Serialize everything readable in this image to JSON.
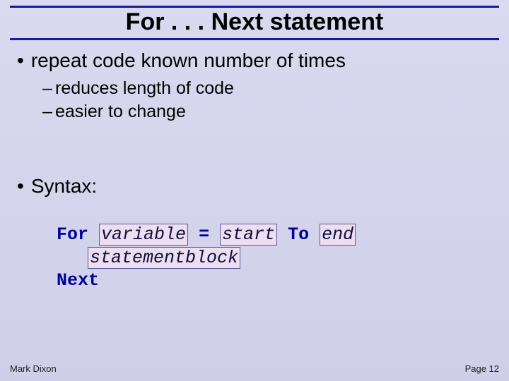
{
  "title": "For . . . Next statement",
  "bullets": {
    "main1": "repeat code known number of times",
    "sub1": "reduces length of code",
    "sub2": "easier to change",
    "main2": "Syntax:"
  },
  "code": {
    "kw_for": "For",
    "ph_variable": "variable",
    "eq": " = ",
    "ph_start": "start",
    "kw_to": " To ",
    "ph_end": "end",
    "ph_block": "statementblock",
    "kw_next": "Next"
  },
  "footer": {
    "author": "Mark Dixon",
    "page": "Page 12"
  }
}
